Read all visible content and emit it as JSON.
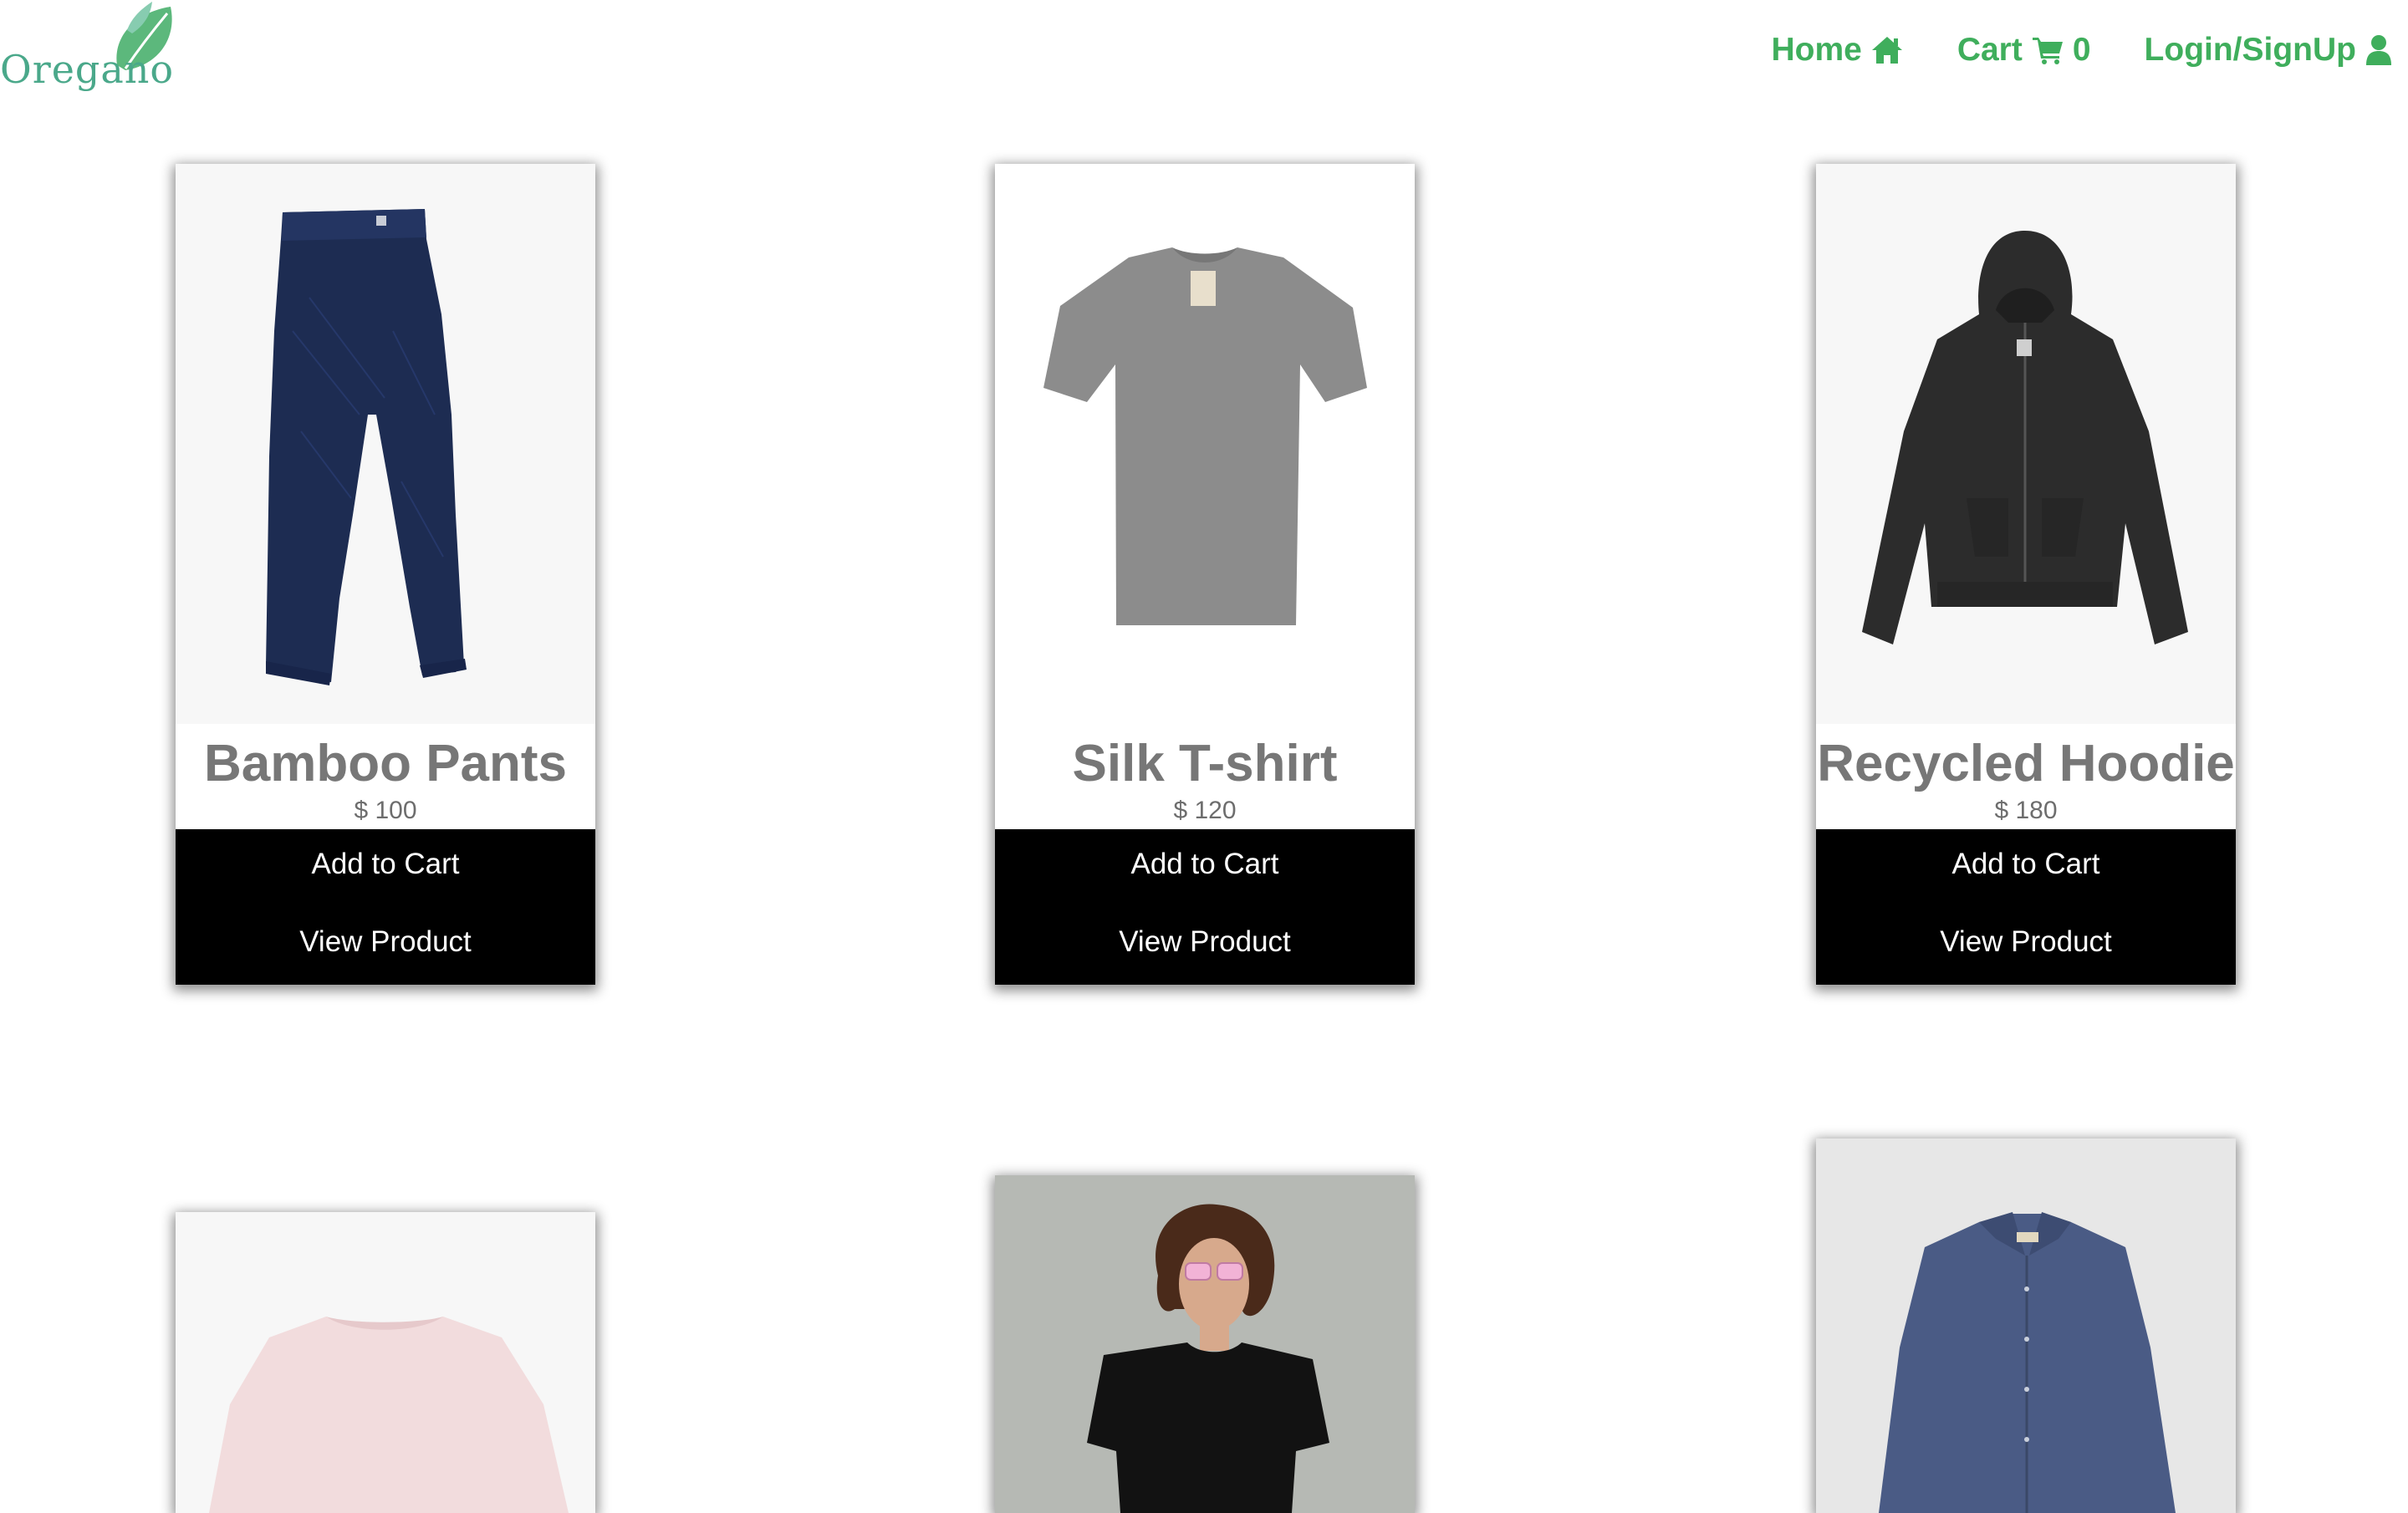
{
  "brand": {
    "name": "Oregano",
    "logo_icon": "leaf-icon",
    "accent": "#3fae5c",
    "logo_color": "#4aa88a"
  },
  "nav": {
    "home_label": "Home",
    "home_icon": "home-icon",
    "cart_label": "Cart",
    "cart_icon": "cart-icon",
    "cart_count": "0",
    "login_label": "Login/SignUp",
    "login_icon": "user-icon"
  },
  "products": [
    {
      "name": "Bamboo Pants",
      "price": "$ 100",
      "add_label": "Add to Cart",
      "view_label": "View Product",
      "image": "navy-quilted-pants"
    },
    {
      "name": "Silk T-shirt",
      "price": "$ 120",
      "add_label": "Add to Cart",
      "view_label": "View Product",
      "image": "grey-tshirt"
    },
    {
      "name": "Recycled Hoodie",
      "price": "$ 180",
      "add_label": "Add to Cart",
      "view_label": "View Product",
      "image": "black-quilted-hoodie"
    }
  ],
  "products_row2": [
    {
      "image": "pink-sweatshirt"
    },
    {
      "image": "model-black-tshirt-sunglasses"
    },
    {
      "image": "navy-button-shirt"
    }
  ]
}
